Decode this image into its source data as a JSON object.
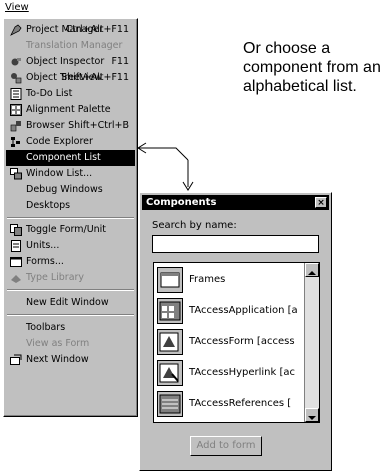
{
  "menubar": {
    "title": "View"
  },
  "menu": {
    "items": [
      {
        "label": "Project Manager",
        "shortcut": "Ctrl+Alt+F11",
        "icon": "project-manager-icon",
        "disabled": false
      },
      {
        "label": "Translation Manager",
        "shortcut": "",
        "icon": "",
        "disabled": true
      },
      {
        "label": "Object Inspector",
        "shortcut": "F11",
        "icon": "object-inspector-icon",
        "disabled": false
      },
      {
        "label": "Object TreeView",
        "shortcut": "Shift+Alt+F11",
        "icon": "treeview-icon",
        "disabled": false
      },
      {
        "label": "To-Do List",
        "shortcut": "",
        "icon": "todo-icon",
        "disabled": false
      },
      {
        "label": "Alignment Palette",
        "shortcut": "",
        "icon": "alignment-icon",
        "disabled": false
      },
      {
        "label": "Browser",
        "shortcut": "Shift+Ctrl+B",
        "icon": "browser-icon",
        "disabled": false
      },
      {
        "label": "Code Explorer",
        "shortcut": "",
        "icon": "code-explorer-icon",
        "disabled": false
      },
      {
        "label": "Component List",
        "shortcut": "",
        "icon": "",
        "disabled": false,
        "selected": true
      },
      {
        "label": "Window List...",
        "shortcut": "",
        "icon": "window-list-icon",
        "disabled": false
      },
      {
        "label": "Debug Windows",
        "shortcut": "",
        "icon": "",
        "disabled": false
      },
      {
        "label": "Desktops",
        "shortcut": "",
        "icon": "",
        "disabled": false
      },
      {
        "label": "Toggle Form/Unit",
        "shortcut": "",
        "icon": "toggle-form-icon",
        "disabled": false
      },
      {
        "label": "Units...",
        "shortcut": "",
        "icon": "units-icon",
        "disabled": false
      },
      {
        "label": "Forms...",
        "shortcut": "",
        "icon": "forms-icon",
        "disabled": false
      },
      {
        "label": "Type Library",
        "shortcut": "",
        "icon": "type-library-icon",
        "disabled": true
      },
      {
        "label": "New Edit Window",
        "shortcut": "",
        "icon": "",
        "disabled": false
      },
      {
        "label": "Toolbars",
        "shortcut": "",
        "icon": "",
        "disabled": false
      },
      {
        "label": "View as Form",
        "shortcut": "",
        "icon": "",
        "disabled": true
      },
      {
        "label": "Next Window",
        "shortcut": "",
        "icon": "next-window-icon",
        "disabled": false
      }
    ]
  },
  "callout": {
    "text": "Or choose a component from an alphabetical list."
  },
  "components": {
    "title": "Components",
    "close": "×",
    "search_label": "Search by name:",
    "search_value": "",
    "items": [
      {
        "label": "Frames",
        "icon": "frames-icon"
      },
      {
        "label": "TAccessApplication [a",
        "icon": "access-application-icon"
      },
      {
        "label": "TAccessForm [access",
        "icon": "access-form-icon"
      },
      {
        "label": "TAccessHyperlink [ac",
        "icon": "access-hyperlink-icon"
      },
      {
        "label": "TAccessReferences [",
        "icon": "access-references-icon"
      }
    ],
    "add_button": "Add to form"
  },
  "colors": {
    "face": "#c0c0c0",
    "highlight": "#000000",
    "disabled": "#808080"
  }
}
